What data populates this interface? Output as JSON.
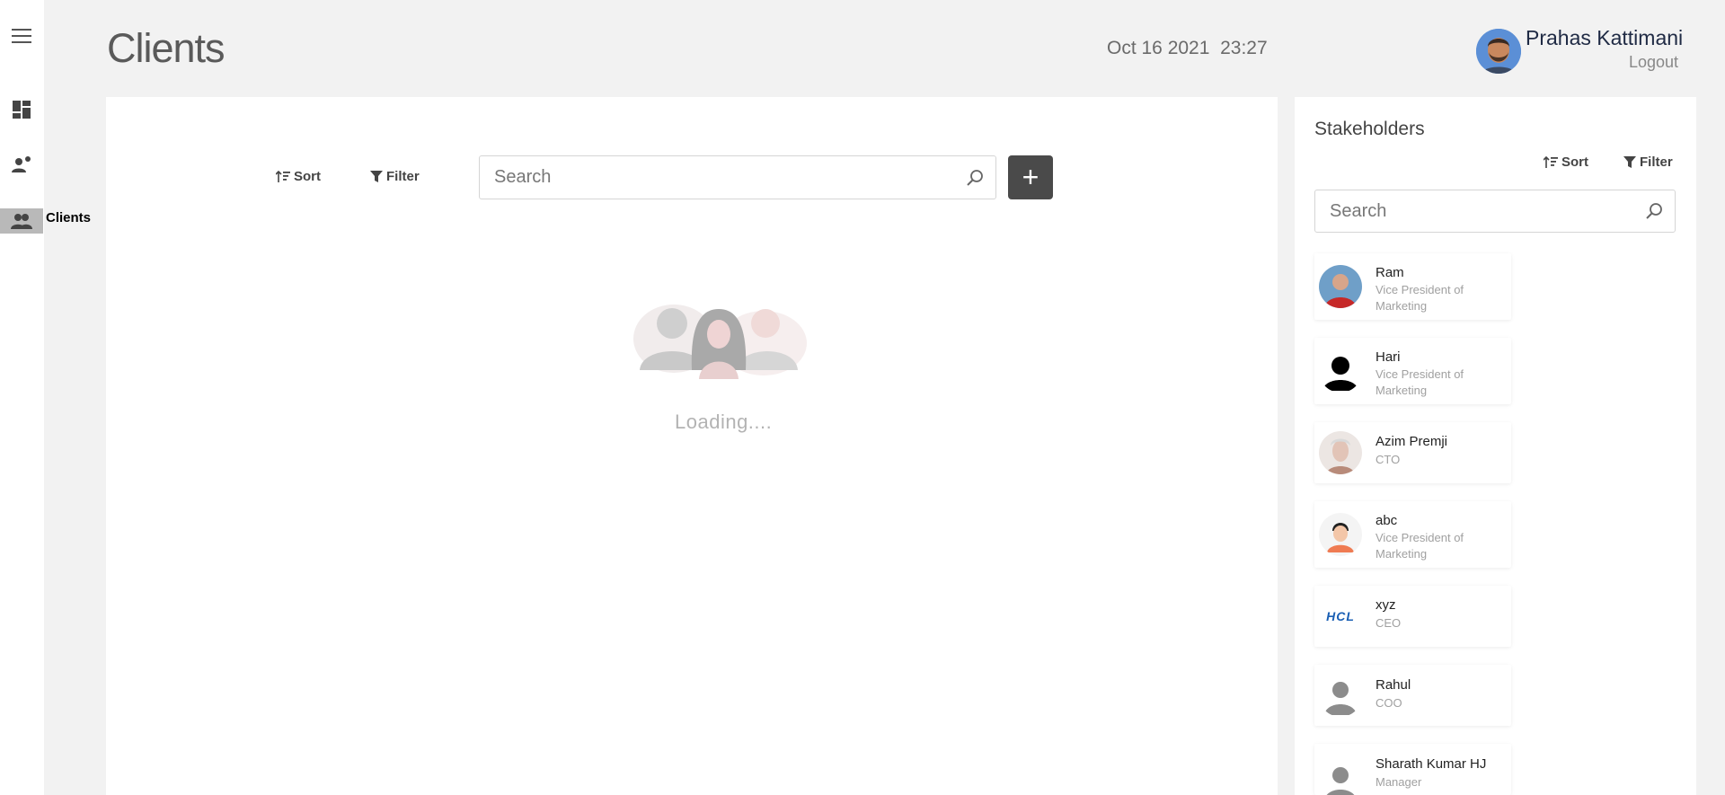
{
  "nav": {
    "menu_icon": "hamburger-icon",
    "items": [
      {
        "icon": "dashboard-icon"
      },
      {
        "icon": "person-add-icon"
      },
      {
        "icon": "people-icon",
        "label": "Clients"
      }
    ]
  },
  "header": {
    "title": "Clients",
    "datetime": "Oct 16 2021  23:27",
    "user_name": "Prahas Kattimani",
    "logout": "Logout"
  },
  "main": {
    "sort_label": "Sort",
    "filter_label": "Filter",
    "search_placeholder": "Search",
    "add_label": "+",
    "loading_text": "Loading...."
  },
  "stakeholders": {
    "title": "Stakeholders",
    "sort_label": "Sort",
    "filter_label": "Filter",
    "search_placeholder": "Search",
    "items": [
      {
        "name": "Ram",
        "role": "Vice President of Marketing"
      },
      {
        "name": "Hari",
        "role": "Vice President of Marketing"
      },
      {
        "name": "Azim Premji",
        "role": "CTO"
      },
      {
        "name": "abc",
        "role": "Vice President of Marketing"
      },
      {
        "name": "xyz",
        "role": "CEO",
        "logo_text": "HCL"
      },
      {
        "name": "Rahul",
        "role": "COO"
      },
      {
        "name": "Sharath Kumar HJ",
        "role": "Manager"
      }
    ]
  },
  "colors": {
    "accent_dark": "#4a4a4a",
    "nav_active": "#b9b9b9",
    "hcl_blue": "#1a5fb4"
  }
}
